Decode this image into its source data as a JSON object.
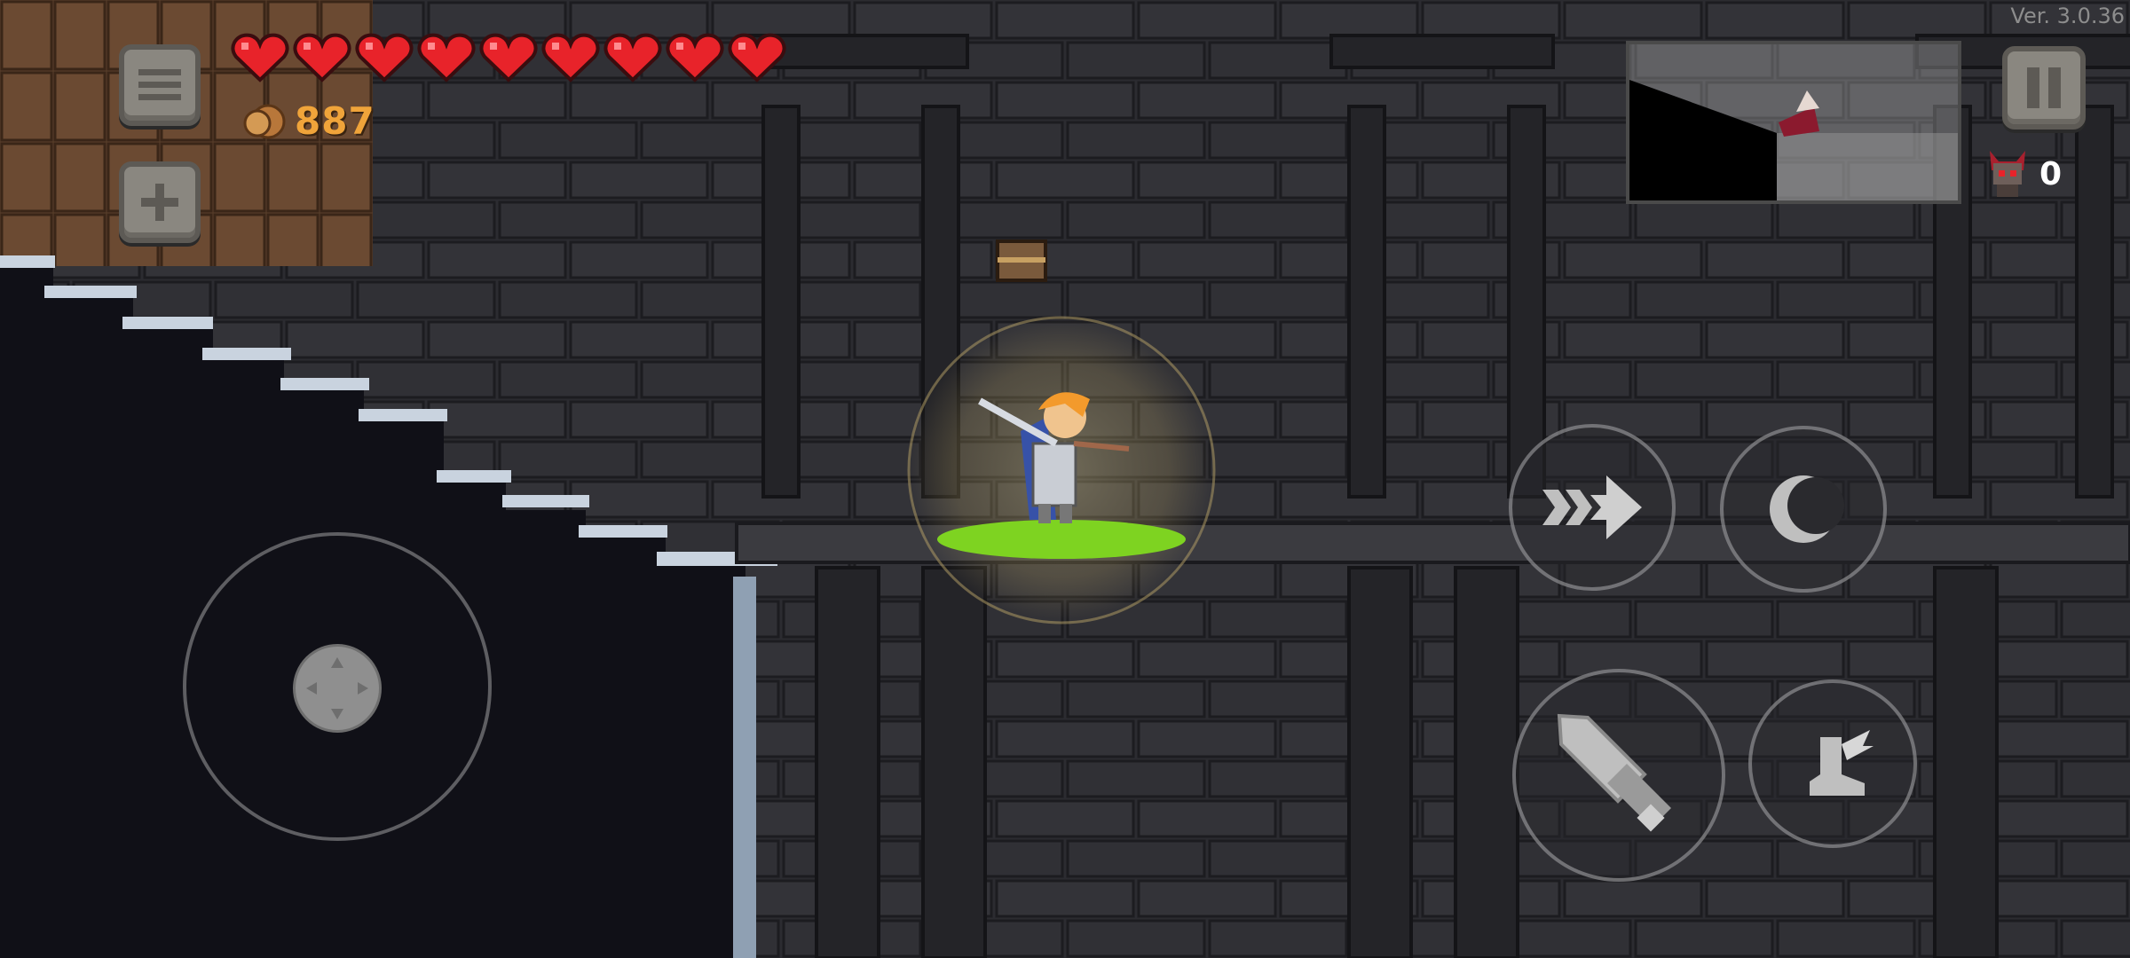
{
  "version_label": "Ver. 3.0.36",
  "hud": {
    "hearts": {
      "filled": 9,
      "total": 9,
      "color": "#e8232a"
    },
    "coins": "887",
    "kill_count": "0",
    "menu_icon": "menu-icon",
    "add_icon": "plus-icon",
    "pause_icon": "pause-icon"
  },
  "controls": {
    "dash_icon": "dash-arrow-icon",
    "skill_icon": "crescent-moon-icon",
    "attack_icon": "sword-icon",
    "jump_icon": "winged-boot-icon",
    "joystick_icon": "dpad-icon"
  },
  "colors": {
    "coin_text": "#f0a43a",
    "slime": "#7ed321",
    "aura": "#d8c48a"
  }
}
